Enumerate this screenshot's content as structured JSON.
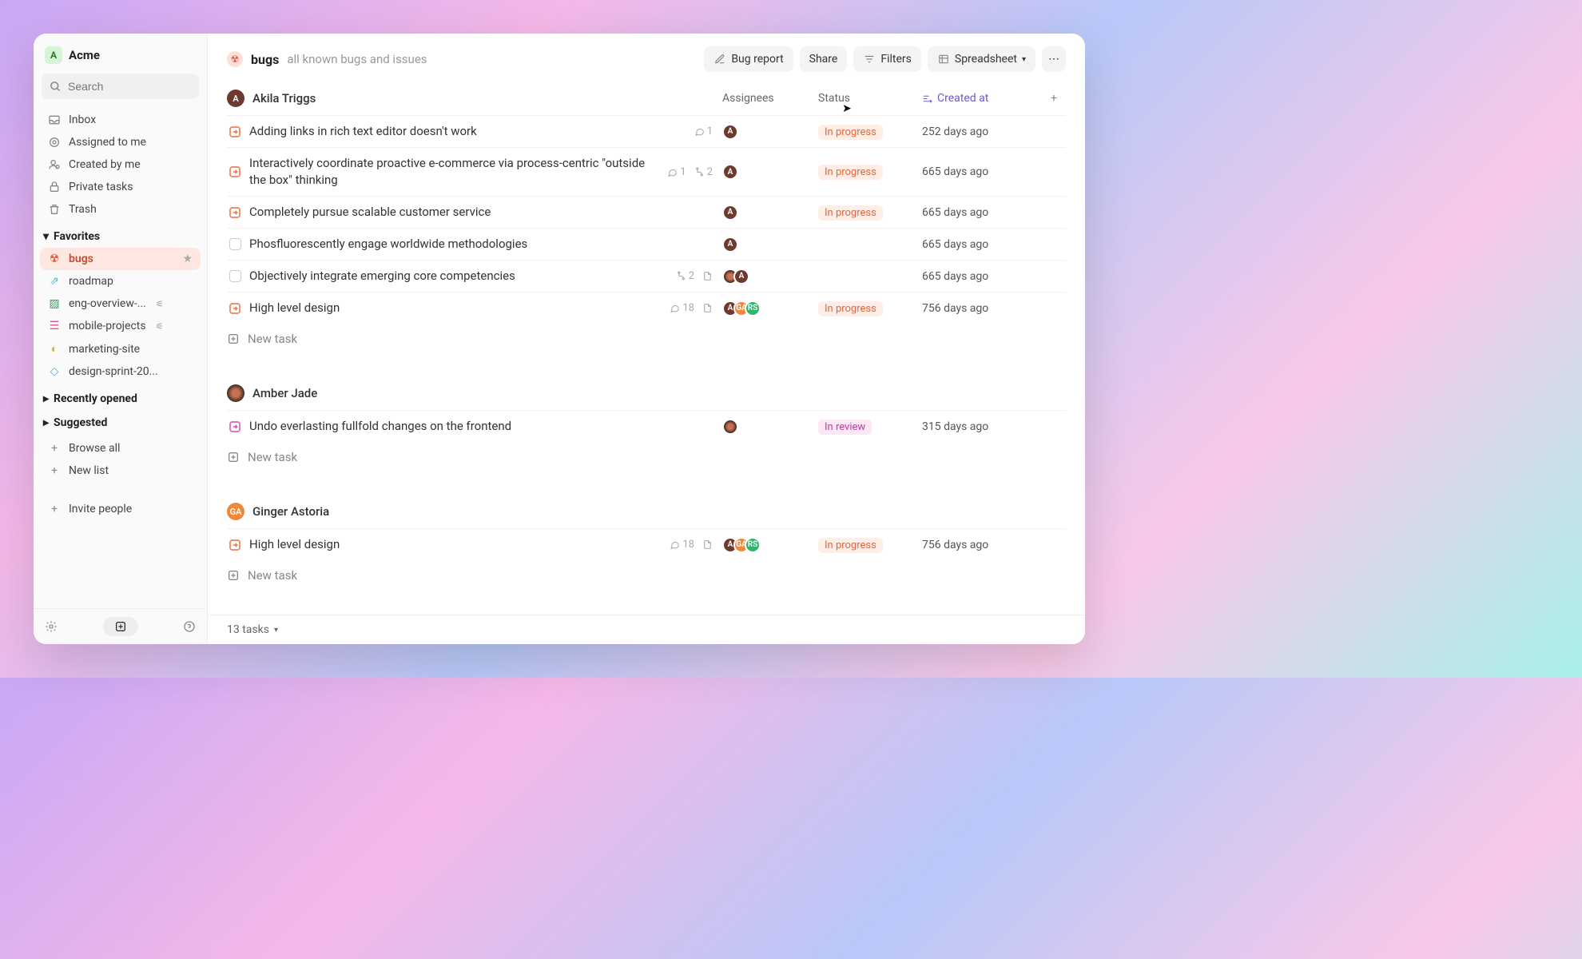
{
  "workspace": {
    "badge": "A",
    "name": "Acme"
  },
  "search": {
    "placeholder": "Search"
  },
  "nav": {
    "inbox": "Inbox",
    "assigned": "Assigned to me",
    "created": "Created by me",
    "private": "Private tasks",
    "trash": "Trash"
  },
  "sections": {
    "favorites": "Favorites",
    "recent": "Recently opened",
    "suggested": "Suggested"
  },
  "favorites": [
    {
      "label": "bugs",
      "active": true
    },
    {
      "label": "roadmap"
    },
    {
      "label": "eng-overview-..."
    },
    {
      "label": "mobile-projects"
    },
    {
      "label": "marketing-site"
    },
    {
      "label": "design-sprint-20..."
    }
  ],
  "bottom_nav": {
    "browse": "Browse all",
    "new_list": "New list",
    "invite": "Invite people"
  },
  "header": {
    "title": "bugs",
    "subtitle": "all known bugs and issues",
    "bug_report": "Bug report",
    "share": "Share",
    "filters": "Filters",
    "view": "Spreadsheet"
  },
  "columns": {
    "assignees": "Assignees",
    "status": "Status",
    "created": "Created at"
  },
  "statuses": {
    "in_progress": "In progress",
    "in_review": "In review"
  },
  "new_task": "New task",
  "groups": [
    {
      "name": "Akila Triggs",
      "avatar": "brown",
      "avatar_text": "A",
      "tasks": [
        {
          "icon": "arrow",
          "title": "Adding links in rich text editor doesn't work",
          "comments": "1",
          "assignees": [
            {
              "c": "brown",
              "t": "A"
            }
          ],
          "status": "in_progress",
          "created": "252 days ago"
        },
        {
          "icon": "arrow",
          "title": "Interactively coordinate proactive e-commerce via process-centric \"outside the box\" thinking",
          "comments": "1",
          "subtasks": "2",
          "assignees": [
            {
              "c": "brown",
              "t": "A"
            }
          ],
          "status": "in_progress",
          "created": "665 days ago"
        },
        {
          "icon": "arrow",
          "title": "Completely pursue scalable customer service",
          "assignees": [
            {
              "c": "brown",
              "t": "A"
            }
          ],
          "status": "in_progress",
          "created": "665 days ago"
        },
        {
          "icon": "checkbox",
          "title": "Phosfluorescently engage worldwide methodologies",
          "assignees": [
            {
              "c": "brown",
              "t": "A"
            }
          ],
          "created": "665 days ago"
        },
        {
          "icon": "checkbox",
          "title": "Objectively integrate emerging core competencies",
          "doc": true,
          "subtasks": "2",
          "assignees": [
            {
              "c": "img",
              "t": ""
            },
            {
              "c": "brown",
              "t": "A"
            }
          ],
          "created": "665 days ago"
        },
        {
          "icon": "arrow",
          "title": "High level design",
          "comments": "18",
          "doc": true,
          "assignees": [
            {
              "c": "brown",
              "t": "A"
            },
            {
              "c": "orange",
              "t": "GA"
            },
            {
              "c": "green",
              "t": "RS"
            }
          ],
          "status": "in_progress",
          "created": "756 days ago"
        }
      ]
    },
    {
      "name": "Amber Jade",
      "avatar": "img",
      "avatar_text": "",
      "tasks": [
        {
          "icon": "arrow-pink",
          "title": "Undo everlasting fullfold changes on the frontend",
          "assignees": [
            {
              "c": "img",
              "t": ""
            }
          ],
          "status": "in_review",
          "created": "315 days ago"
        }
      ]
    },
    {
      "name": "Ginger Astoria",
      "avatar": "orange",
      "avatar_text": "GA",
      "tasks": [
        {
          "icon": "arrow",
          "title": "High level design",
          "comments": "18",
          "doc": true,
          "assignees": [
            {
              "c": "brown",
              "t": "A"
            },
            {
              "c": "orange",
              "t": "GA"
            },
            {
              "c": "green",
              "t": "RS"
            }
          ],
          "status": "in_progress",
          "created": "756 days ago"
        }
      ]
    }
  ],
  "footer": {
    "count": "13 tasks"
  }
}
